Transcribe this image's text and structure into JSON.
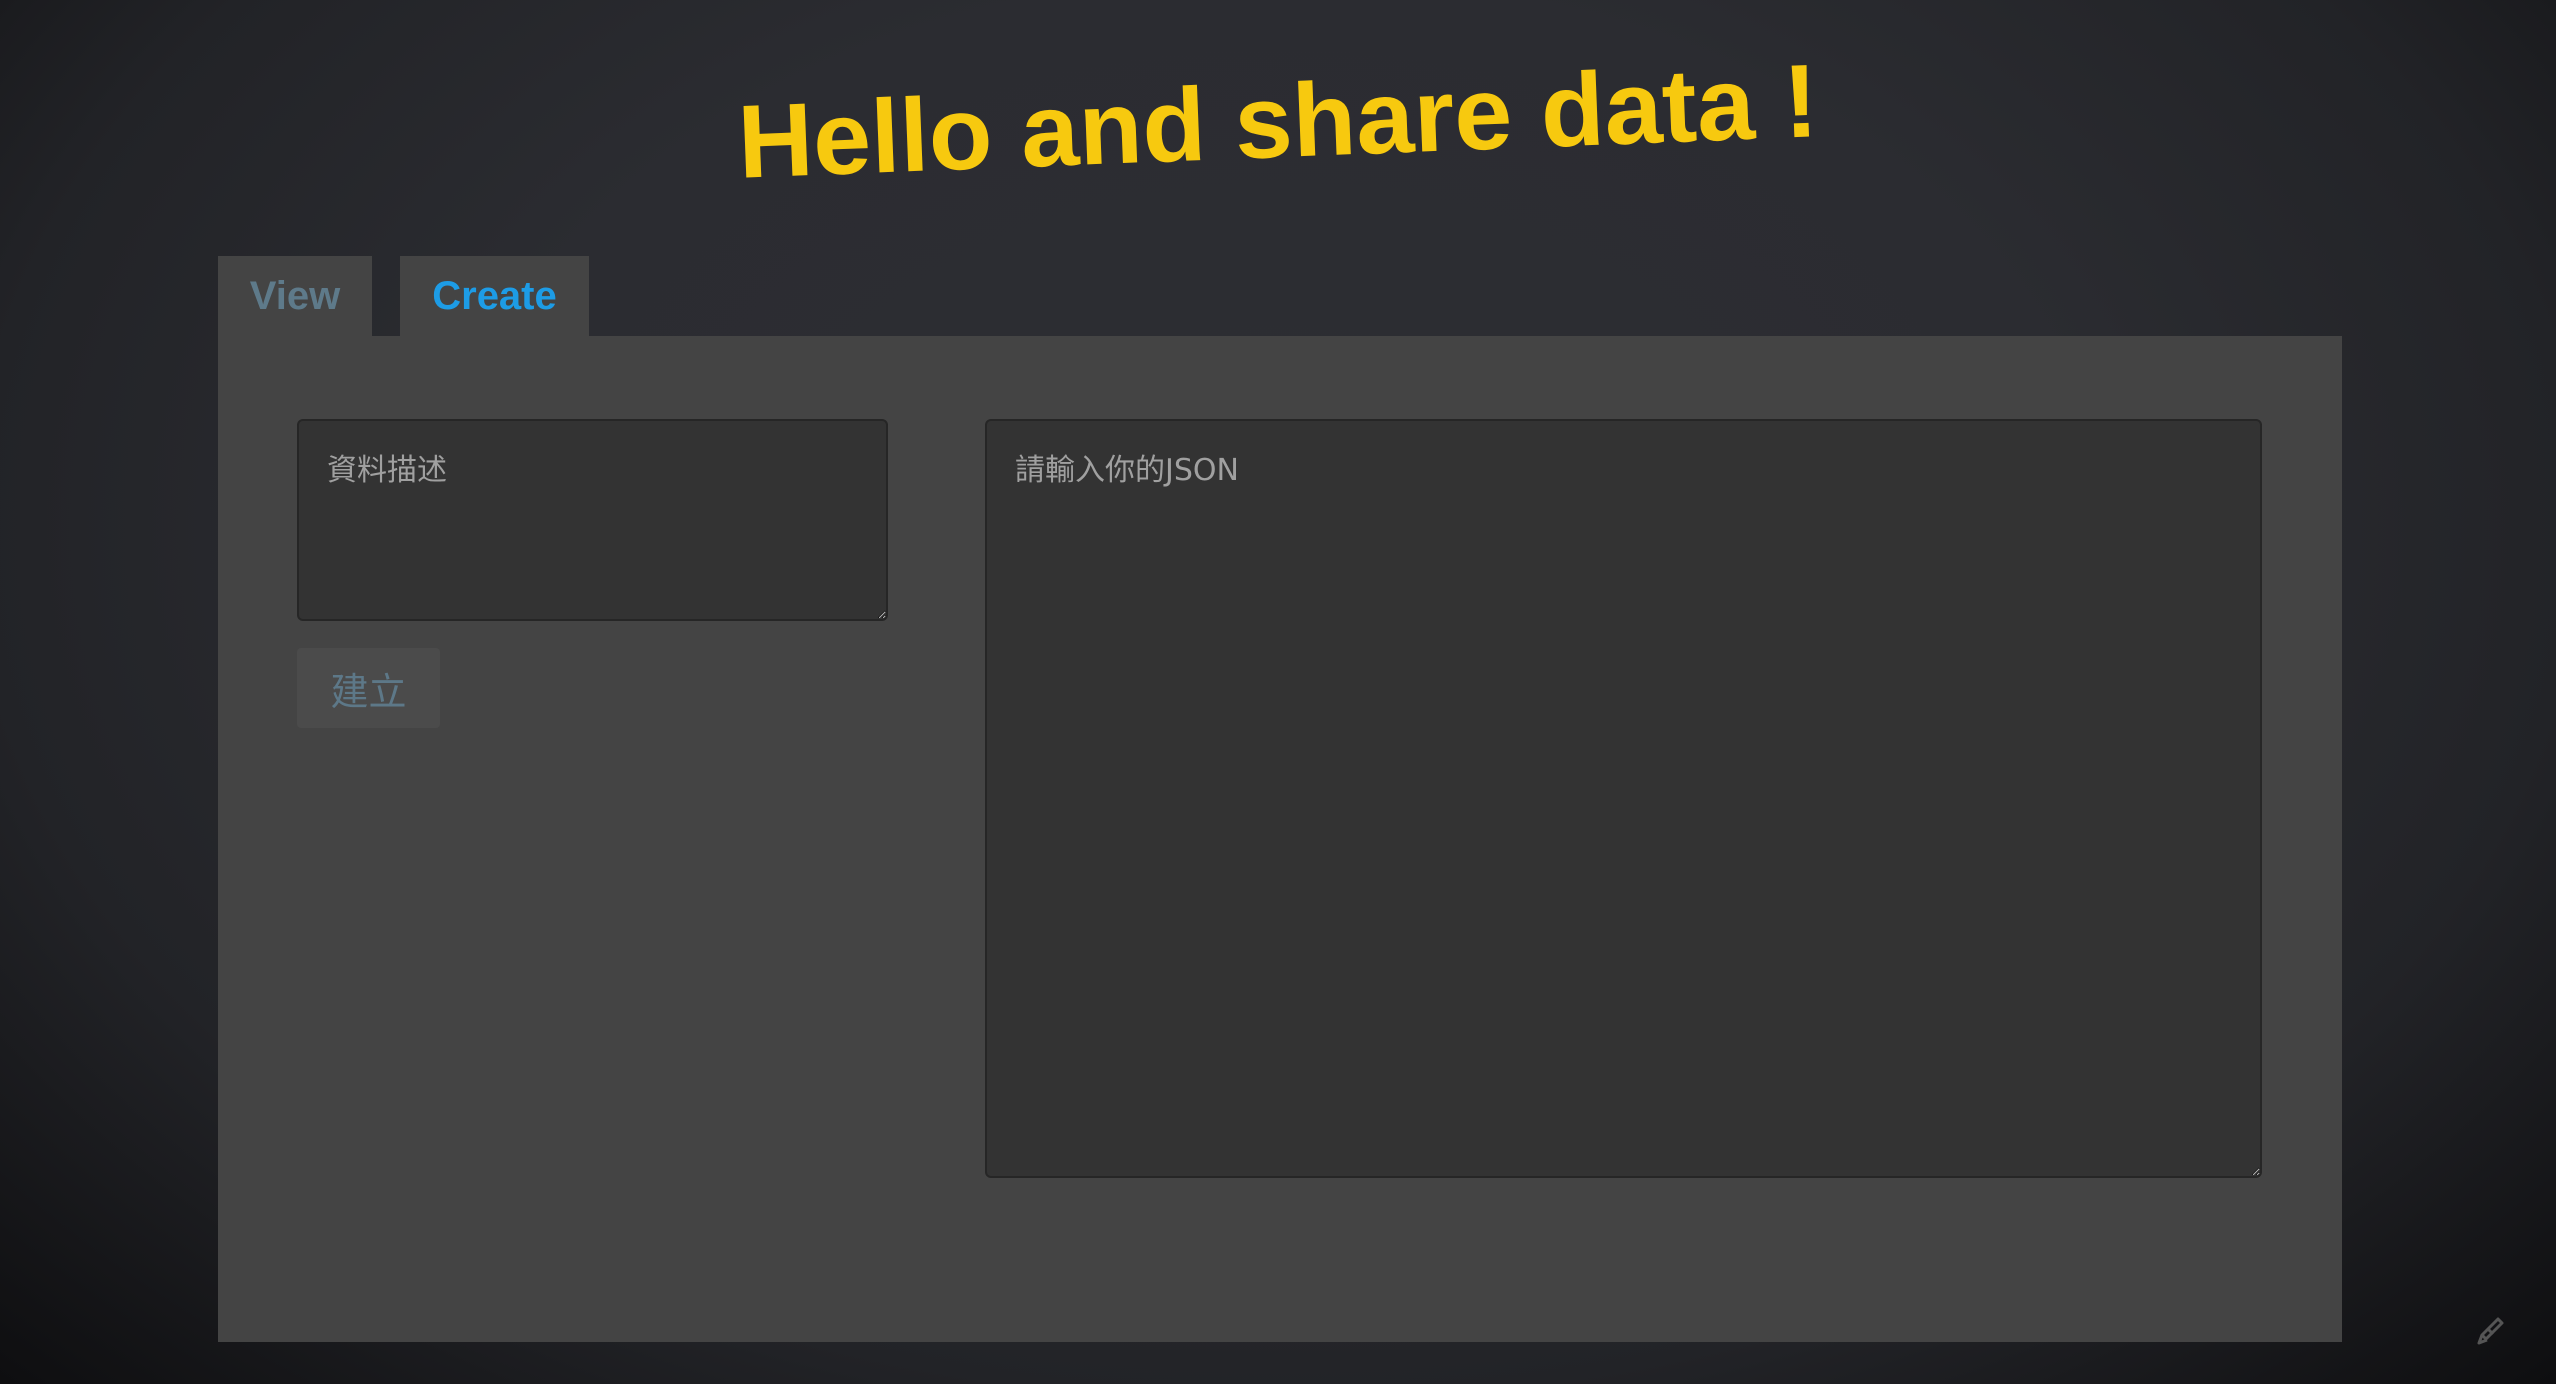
{
  "header": {
    "title": "Hello and share data !",
    "title_color": "#f7c90f"
  },
  "tabs": [
    {
      "label": "View",
      "active": false,
      "color": "#5e7a8a"
    },
    {
      "label": "Create",
      "active": true,
      "color": "#1d9ce6"
    }
  ],
  "form": {
    "description_placeholder": "資料描述",
    "description_value": "",
    "json_placeholder": "請輸入你的JSON",
    "json_value": "",
    "submit_label": "建立"
  },
  "icons": {
    "corner": "feather-quill-icon"
  }
}
